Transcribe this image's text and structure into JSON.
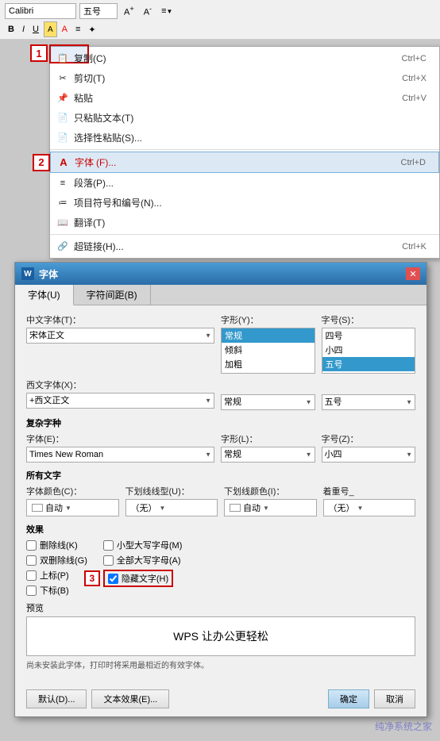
{
  "toolbar": {
    "font_name": "Calibri",
    "font_size": "五号",
    "bold_label": "B",
    "italic_label": "I",
    "underline_label": "U"
  },
  "step_labels": {
    "step1": "1",
    "step2": "2",
    "step3": "3"
  },
  "context_menu": {
    "items": [
      {
        "icon": "📋",
        "label": "复制(C)",
        "shortcut": "Ctrl+C"
      },
      {
        "icon": "✂",
        "label": "剪切(T)",
        "shortcut": "Ctrl+X"
      },
      {
        "icon": "📌",
        "label": "粘贴",
        "shortcut": "Ctrl+V"
      },
      {
        "icon": "📄",
        "label": "只粘贴文本(T)",
        "shortcut": ""
      },
      {
        "icon": "📄",
        "label": "选择性粘贴(S)...",
        "shortcut": ""
      }
    ],
    "font_item": {
      "icon": "A",
      "label": "字体(F)...",
      "shortcut": "Ctrl+D"
    },
    "paragraph_item": {
      "icon": "≡",
      "label": "段落(P)...",
      "shortcut": ""
    },
    "bullets_item": {
      "icon": "≔",
      "label": "项目符号和编号(N)...",
      "shortcut": ""
    },
    "translate_item": {
      "icon": "📖",
      "label": "翻译(T)",
      "shortcut": ""
    },
    "hyperlink_item": {
      "icon": "🔗",
      "label": "超链接(H)...",
      "shortcut": "Ctrl+K"
    }
  },
  "dialog": {
    "title": "字体",
    "tabs": [
      "字体(U)",
      "字符间距(B)"
    ],
    "active_tab": 0,
    "chinese_font_label": "中文字体(T)：",
    "chinese_font_value": "宋体正文",
    "west_font_label": "西文字体(X)：",
    "west_font_value": "+西文正文",
    "style_label": "字形(Y)：",
    "style_value": "常规",
    "style_options": [
      "常规",
      "倾斜",
      "加粗"
    ],
    "size_label": "字号(S)：",
    "size_value": "五号",
    "size_options": [
      "四号",
      "小四",
      "五号"
    ],
    "complex_section": "复杂字种",
    "complex_font_label": "字体(E)：",
    "complex_font_value": "Times New Roman",
    "complex_style_label": "字形(L)：",
    "complex_style_value": "常规",
    "complex_size_label": "字号(Z)：",
    "complex_size_value": "小四",
    "all_text_section": "所有文字",
    "font_color_label": "字体颜色(C)：",
    "font_color_value": "自动",
    "underline_type_label": "下划线线型(U)：",
    "underline_type_value": "（无）",
    "underline_color_label": "下划线颜色(I)：",
    "underline_color_value": "自动",
    "emphasis_label": "着重号_",
    "emphasis_value": "（无）",
    "effects_section": "效果",
    "effects": [
      {
        "label": "删除线(K)",
        "checked": false
      },
      {
        "label": "双删除线(G)",
        "checked": false
      },
      {
        "label": "上标(P)",
        "checked": false
      },
      {
        "label": "下标(B)",
        "checked": false
      }
    ],
    "effects2": [
      {
        "label": "小型大写字母(M)",
        "checked": false
      },
      {
        "label": "全部大写字母(A)",
        "checked": false
      },
      {
        "label": "隐藏文字(H)",
        "checked": true
      }
    ],
    "preview_label": "预览",
    "preview_text": "WPS 让办公更轻松",
    "preview_note": "尚未安装此字体，打印时将采用最相近的有效字体。",
    "btn_default": "默认(D)...",
    "btn_text_effect": "文本效果(E)...",
    "btn_ok": "确定",
    "btn_cancel": "取消"
  },
  "watermark": "纯净系统之家"
}
